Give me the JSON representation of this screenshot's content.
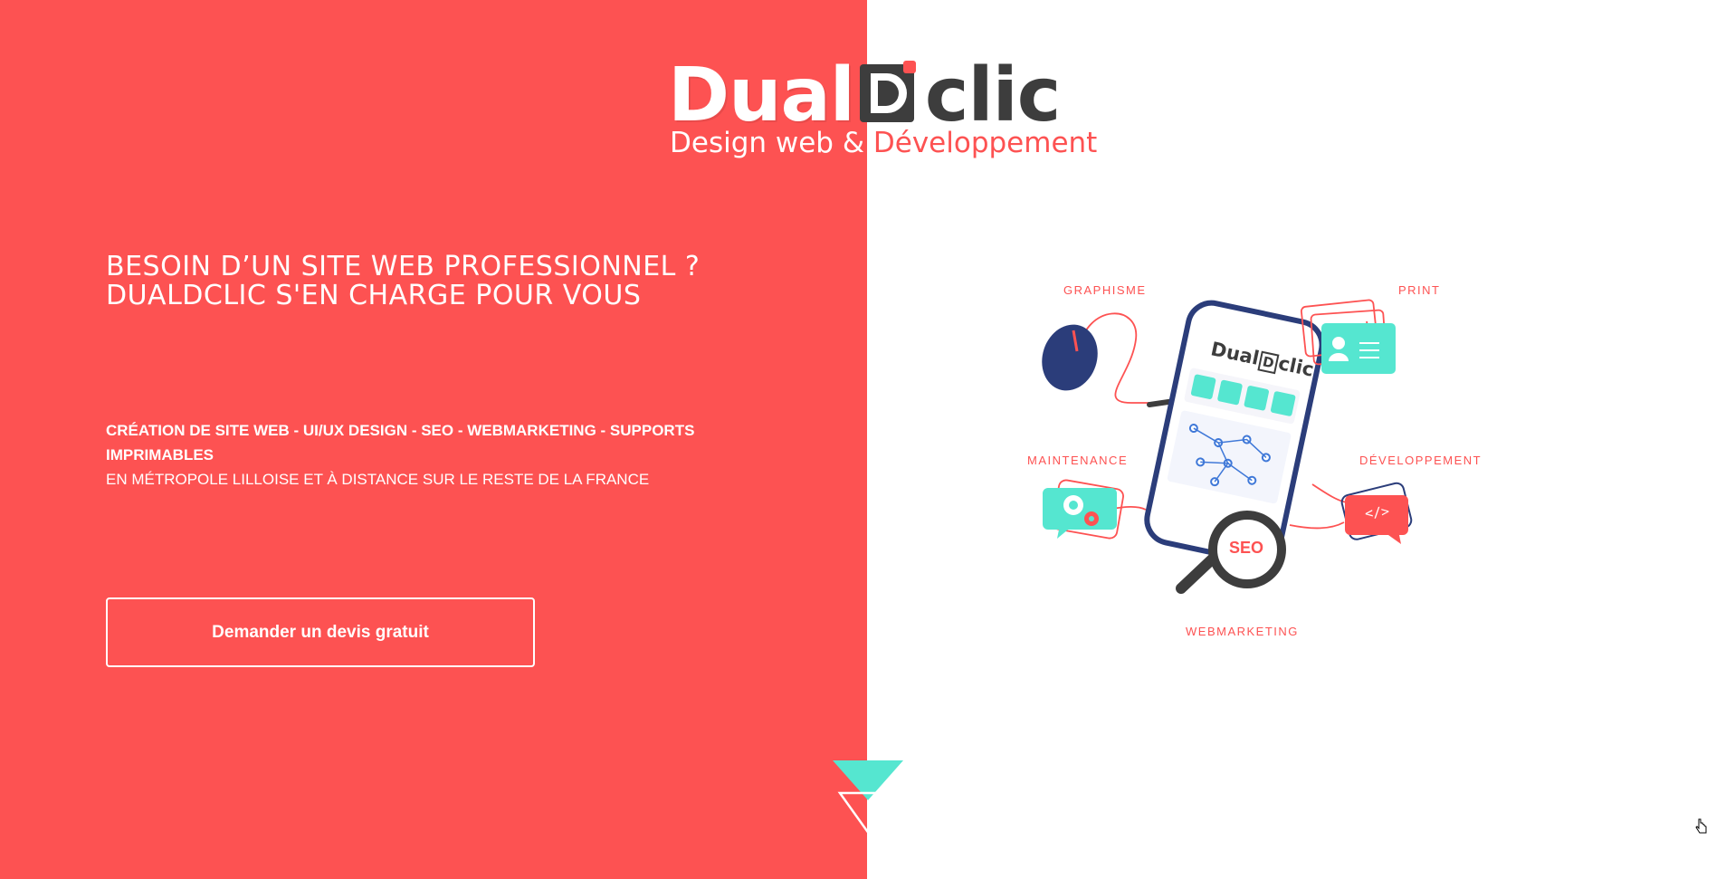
{
  "brand": {
    "name_left": "Dual",
    "name_right": "clic",
    "mark_letter": "D",
    "tagline_left": "Design web & ",
    "tagline_right": "Développement"
  },
  "hero": {
    "title_line1": "BESOIN D’UN SITE WEB PROFESSIONNEL ?",
    "title_line2": "DUALDCLIC S'EN CHARGE POUR VOUS",
    "services_line": "CRÉATION DE SITE WEB - UI/UX DESIGN - SEO - WEBMARKETING - SUPPORTS IMPRIMABLES",
    "location_line": "EN MÉTROPOLE LILLOISE ET À DISTANCE SUR LE RESTE DE LA FRANCE",
    "cta_label": "Demander un devis gratuit"
  },
  "illustration": {
    "labels": {
      "graphisme": "GRAPHISME",
      "print": "PRINT",
      "maintenance": "MAINTENANCE",
      "developpement": "DÉVELOPPEMENT",
      "webmarketing": "WEBMARKETING"
    },
    "phone_brand_left": "Dual",
    "phone_brand_mark": "D",
    "phone_brand_right": "clic",
    "seo_text": "SEO",
    "code_text": "</>"
  },
  "colors": {
    "accent_red": "#fd5252",
    "teal": "#55e6d0",
    "navy": "#2b3d7a",
    "dark_gray": "#3d3d3d",
    "white": "#ffffff"
  }
}
